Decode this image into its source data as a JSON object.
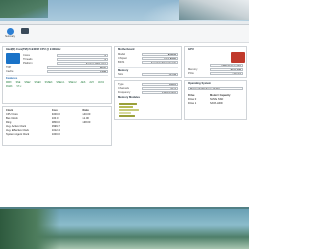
{
  "toolbar": {
    "buttons": [
      {
        "label": "Summary",
        "icon": "summary-icon",
        "color": "#2d7fd3"
      },
      {
        "label": "",
        "icon": "monitor-icon",
        "color": "#3a4a5a"
      }
    ]
  },
  "cpu": {
    "title": "CPU",
    "name": "Intel(R) Core(TM) i5-9400F CPU @ 2.90GHz",
    "rows": [
      {
        "k": "Cores",
        "v": "6"
      },
      {
        "k": "Threads",
        "v": "6"
      },
      {
        "k": "Platform",
        "v": "Socket 1151 LGA"
      },
      {
        "k": "TDP",
        "v": "65 W"
      },
      {
        "k": "Cache",
        "v": "9 MB"
      }
    ],
    "brand_color": "#1a73c8"
  },
  "motherboard": {
    "title": "Motherboard",
    "rows": [
      {
        "k": "Model",
        "v": "B365M"
      },
      {
        "k": "Chipset",
        "v": "Intel B365"
      },
      {
        "k": "BIOS",
        "v": "American Megatrends"
      }
    ]
  },
  "gpu": {
    "title": "GPU",
    "rows": [
      {
        "k": "",
        "v": "AMD Radeon RX"
      },
      {
        "k": "Memory",
        "v": "8192 MB"
      },
      {
        "k": "PCIe",
        "v": "x16 3.0"
      }
    ],
    "brand_color": "#c0392b"
  },
  "memory": {
    "title": "Memory",
    "rows": [
      {
        "k": "Size",
        "v": "16 GB"
      },
      {
        "k": "Type",
        "v": "DDR4"
      },
      {
        "k": "Channels",
        "v": "Dual"
      },
      {
        "k": "Frequency",
        "v": "1333.0 MHz"
      }
    ],
    "modules_title": "Memory Modules",
    "bar_color": "#9aa03a"
  },
  "features": {
    "title": "Features",
    "items": [
      "MMX",
      "SSE",
      "SSE2",
      "SSE3",
      "SSSE3",
      "SSE4.1",
      "SSE4.2",
      "AES",
      "AVX",
      "AVX2",
      "FMA3",
      "VT-x"
    ]
  },
  "clocks": {
    "headers": [
      "Clock",
      "Core",
      "Ratio"
    ],
    "rows": [
      {
        "name": "CPU Core",
        "a": "4000.0",
        "b": "x40.00"
      },
      {
        "name": "Bus Clock",
        "a": "100.0",
        "b": "x1.00"
      },
      {
        "name": "Ring",
        "a": "3800.0",
        "b": "x38.00"
      },
      {
        "name": "Avg. Active Clock",
        "a": "3999.7",
        "b": ""
      },
      {
        "name": "Avg. Effective Clock",
        "a": "1012.4",
        "b": ""
      },
      {
        "name": "System Agent Clock",
        "a": "1000.0",
        "b": ""
      }
    ]
  },
  "drives": {
    "headers": [
      "Drive",
      "Model / Capacity"
    ],
    "rows": [
      {
        "name": "Drive 0",
        "v": "NVMe SSD"
      },
      {
        "name": "Drive 1",
        "v": "SATA HDD"
      }
    ]
  },
  "os": {
    "title": "Operating System",
    "value": "Microsoft Windows 10 Pro"
  }
}
